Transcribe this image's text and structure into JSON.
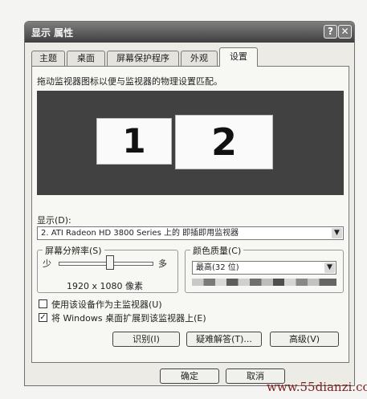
{
  "window": {
    "title": "显示 属性",
    "help_glyph": "?",
    "close_glyph": "✕"
  },
  "tabs": [
    {
      "label": "主题",
      "active": false
    },
    {
      "label": "桌面",
      "active": false
    },
    {
      "label": "屏幕保护程序",
      "active": false
    },
    {
      "label": "外观",
      "active": false
    },
    {
      "label": "设置",
      "active": true
    }
  ],
  "settings": {
    "instruction": "拖动监视器图标以便与监视器的物理设置匹配。",
    "monitors": [
      "1",
      "2"
    ],
    "display_label": "显示(D):",
    "display_value": "2. ATI Radeon HD 3800 Series  上的 即插即用监视器",
    "resolution": {
      "legend": "屏幕分辨率(S)",
      "less_label": "少",
      "more_label": "多",
      "slider_level": 0.55,
      "value_text": "1920 x 1080 像素"
    },
    "color_quality": {
      "legend": "颜色质量(C)",
      "value": "最高(32 位)"
    },
    "primary_checkbox": {
      "label": "使用该设备作为主监视器(U)",
      "checked": false
    },
    "extend_checkbox": {
      "label": "将 Windows 桌面扩展到该监视器上(E)",
      "checked": true
    },
    "buttons": {
      "identify": "识别(I)",
      "troubleshoot": "疑难解答(T)...",
      "advanced": "高级(V)"
    }
  },
  "footer": {
    "ok": "确定",
    "cancel": "取消"
  },
  "watermark": "www.55dianzi.com"
}
